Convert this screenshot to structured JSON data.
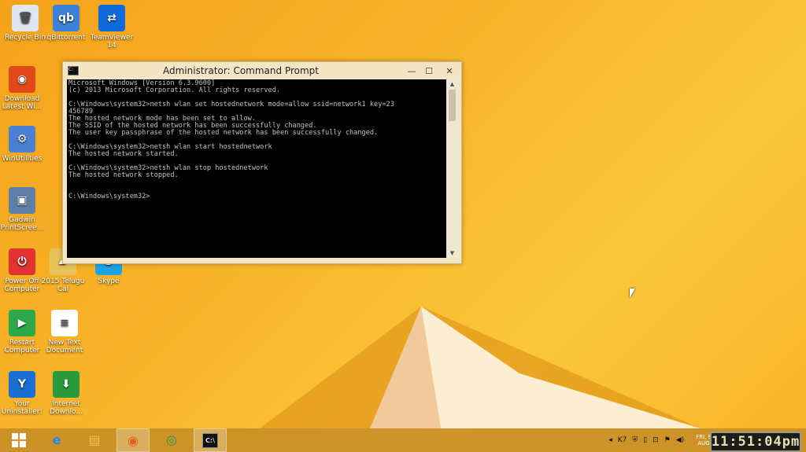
{
  "desktop": {
    "icons": [
      {
        "label": "Recycle Bin",
        "icon": "recycle-bin-icon",
        "color": "#dfe6ee",
        "glyph": "🗑"
      },
      {
        "label": "qBittorrent",
        "icon": "qbittorrent-icon",
        "color": "#3b82d8",
        "glyph": "qb"
      },
      {
        "label": "TeamViewer 14",
        "icon": "teamviewer-icon",
        "color": "#0e6ad9",
        "glyph": "⇄"
      },
      {
        "label": "Download Latest Wi...",
        "icon": "firefox-download-icon",
        "color": "#e04a1a",
        "glyph": "◉"
      },
      {
        "label": "WinUtilities",
        "icon": "winutilities-icon",
        "color": "#4a7fd2",
        "glyph": "⚙"
      },
      {
        "label": "Gadwin PrintScree...",
        "icon": "gadwin-icon",
        "color": "#5d7fa8",
        "glyph": "▣"
      },
      {
        "label": "Power Off Computer",
        "icon": "power-off-icon",
        "color": "#e23232",
        "glyph": "⏻"
      },
      {
        "label": "2015 Telugu Cal",
        "icon": "folder-icon",
        "color": "#e8c15a",
        "glyph": "▰"
      },
      {
        "label": "Skype",
        "icon": "skype-icon",
        "color": "#1fa3e8",
        "glyph": "S"
      },
      {
        "label": "Restart Computer",
        "icon": "restart-icon",
        "color": "#2fa84a",
        "glyph": "▶"
      },
      {
        "label": "New Text Document",
        "icon": "text-document-icon",
        "color": "#ffffff",
        "glyph": "≡"
      },
      {
        "label": "Your Uninstaller!",
        "icon": "uninstaller-icon",
        "color": "#1a6fd0",
        "glyph": "Y"
      },
      {
        "label": "Internet Downlo...",
        "icon": "idm-icon",
        "color": "#2b9a3c",
        "glyph": "⬇"
      }
    ]
  },
  "cmd": {
    "title": "Administrator: Command Prompt",
    "lines": [
      "Microsoft Windows [Version 6.3.9600]",
      "(c) 2013 Microsoft Corporation. All rights reserved.",
      "",
      "C:\\Windows\\system32>netsh wlan set hostednetwork mode=allow ssid=network1 key=23",
      "456789",
      "The hosted network mode has been set to allow.",
      "The SSID of the hosted network has been successfully changed.",
      "The user key passphrase of the hosted network has been successfully changed.",
      "",
      "C:\\Windows\\system32>netsh wlan start hostednetwork",
      "The hosted network started.",
      "",
      "C:\\Windows\\system32>netsh wlan stop hostednetwork",
      "The hosted network stopped.",
      "",
      "",
      "C:\\Windows\\system32>"
    ],
    "buttons": {
      "minimize": "—",
      "maximize": "☐",
      "close": "✕"
    }
  },
  "taskbar": {
    "items": [
      {
        "name": "start-button",
        "icon": "windows-start-icon"
      },
      {
        "name": "ie-button",
        "icon": "internet-explorer-icon",
        "glyph": "e",
        "color": "#1e88e5"
      },
      {
        "name": "explorer-button",
        "icon": "file-explorer-icon",
        "glyph": "▤",
        "color": "#f0c44c"
      },
      {
        "name": "firefox-button",
        "icon": "firefox-icon",
        "glyph": "◉",
        "color": "#e5601c"
      },
      {
        "name": "chrome-button",
        "icon": "chrome-icon",
        "glyph": "◎",
        "color": "#2e9b4a"
      },
      {
        "name": "cmd-button",
        "icon": "command-prompt-icon",
        "glyph": "C:\\",
        "color": "#111111"
      }
    ],
    "tray": {
      "date_line1": "FRI, 9",
      "date_line2": "AUG"
    },
    "clock": "11:51:04pm"
  }
}
